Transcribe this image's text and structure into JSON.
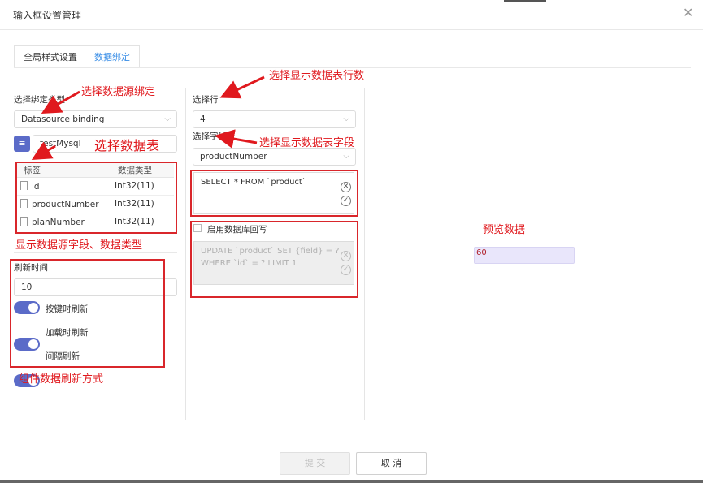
{
  "dialog": {
    "title": "输入框设置管理"
  },
  "tabs": [
    {
      "label": "全局样式设置",
      "active": false
    },
    {
      "label": "数据绑定",
      "active": true
    }
  ],
  "left": {
    "binding_type_label": "选择绑定类型",
    "binding_type_value": "Datasource binding",
    "datasource_name": "testMysql",
    "table_headers": [
      "标签",
      "数据类型"
    ],
    "fields": [
      {
        "name": "id",
        "type": "Int32(11)"
      },
      {
        "name": "productNumber",
        "type": "Int32(11)"
      },
      {
        "name": "planNumber",
        "type": "Int32(11)"
      }
    ],
    "refresh_label": "刷新时间",
    "refresh_value": "10",
    "toggles": [
      {
        "label": "按键时刷新",
        "on": true
      },
      {
        "label": "加载时刷新",
        "on": true
      },
      {
        "label": "间隔刷新",
        "on": true
      }
    ]
  },
  "middle": {
    "row_label": "选择行",
    "row_value": "4",
    "field_label": "选择字段",
    "field_value": "productNumber",
    "select_sql": "SELECT * FROM `product`",
    "writeback_label": "启用数据库回写",
    "writeback_checked": false,
    "update_sql_line1": "UPDATE `product` SET {field} = ?",
    "update_sql_line2": "WHERE `id` = ? LIMIT 1"
  },
  "preview": {
    "label": "预览数据",
    "value": "60"
  },
  "footer": {
    "submit_label": "提 交",
    "cancel_label": "取 消"
  },
  "annotations": {
    "a1": "选择数据源绑定",
    "a2": "选择数据表",
    "a3": "显示数据源字段、数据类型",
    "a4": "组件数据刷新方式",
    "a5": "选择显示数据表行数",
    "a6": "选择显示数据表字段"
  },
  "colors": {
    "accent": "#5b6bc8",
    "tab_active": "#3a8ee6",
    "annotation_red": "#e0191e",
    "preview_bg": "#e9e6fb"
  }
}
